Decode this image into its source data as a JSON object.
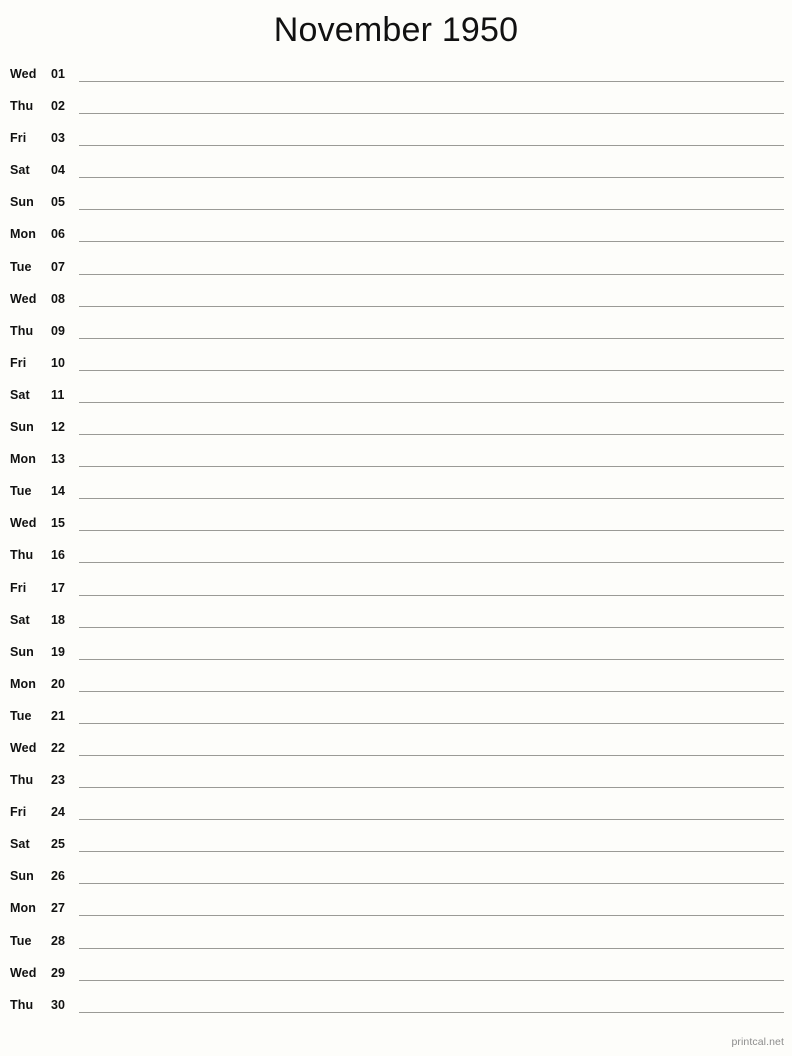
{
  "page": {
    "title": "November 1950",
    "background_color": "#fdfdfa",
    "line_color": "#9a9a96",
    "text_color": "#111111"
  },
  "footer": {
    "label": "printcal.net",
    "color": "#8c8c8c"
  },
  "calendar": {
    "month": "November",
    "year": "1950",
    "layout": "single-column-notepad",
    "days": [
      {
        "weekday": "Wed",
        "date": "01"
      },
      {
        "weekday": "Thu",
        "date": "02"
      },
      {
        "weekday": "Fri",
        "date": "03"
      },
      {
        "weekday": "Sat",
        "date": "04"
      },
      {
        "weekday": "Sun",
        "date": "05"
      },
      {
        "weekday": "Mon",
        "date": "06"
      },
      {
        "weekday": "Tue",
        "date": "07"
      },
      {
        "weekday": "Wed",
        "date": "08"
      },
      {
        "weekday": "Thu",
        "date": "09"
      },
      {
        "weekday": "Fri",
        "date": "10"
      },
      {
        "weekday": "Sat",
        "date": "11"
      },
      {
        "weekday": "Sun",
        "date": "12"
      },
      {
        "weekday": "Mon",
        "date": "13"
      },
      {
        "weekday": "Tue",
        "date": "14"
      },
      {
        "weekday": "Wed",
        "date": "15"
      },
      {
        "weekday": "Thu",
        "date": "16"
      },
      {
        "weekday": "Fri",
        "date": "17"
      },
      {
        "weekday": "Sat",
        "date": "18"
      },
      {
        "weekday": "Sun",
        "date": "19"
      },
      {
        "weekday": "Mon",
        "date": "20"
      },
      {
        "weekday": "Tue",
        "date": "21"
      },
      {
        "weekday": "Wed",
        "date": "22"
      },
      {
        "weekday": "Thu",
        "date": "23"
      },
      {
        "weekday": "Fri",
        "date": "24"
      },
      {
        "weekday": "Sat",
        "date": "25"
      },
      {
        "weekday": "Sun",
        "date": "26"
      },
      {
        "weekday": "Mon",
        "date": "27"
      },
      {
        "weekday": "Tue",
        "date": "28"
      },
      {
        "weekday": "Wed",
        "date": "29"
      },
      {
        "weekday": "Thu",
        "date": "30"
      }
    ]
  }
}
